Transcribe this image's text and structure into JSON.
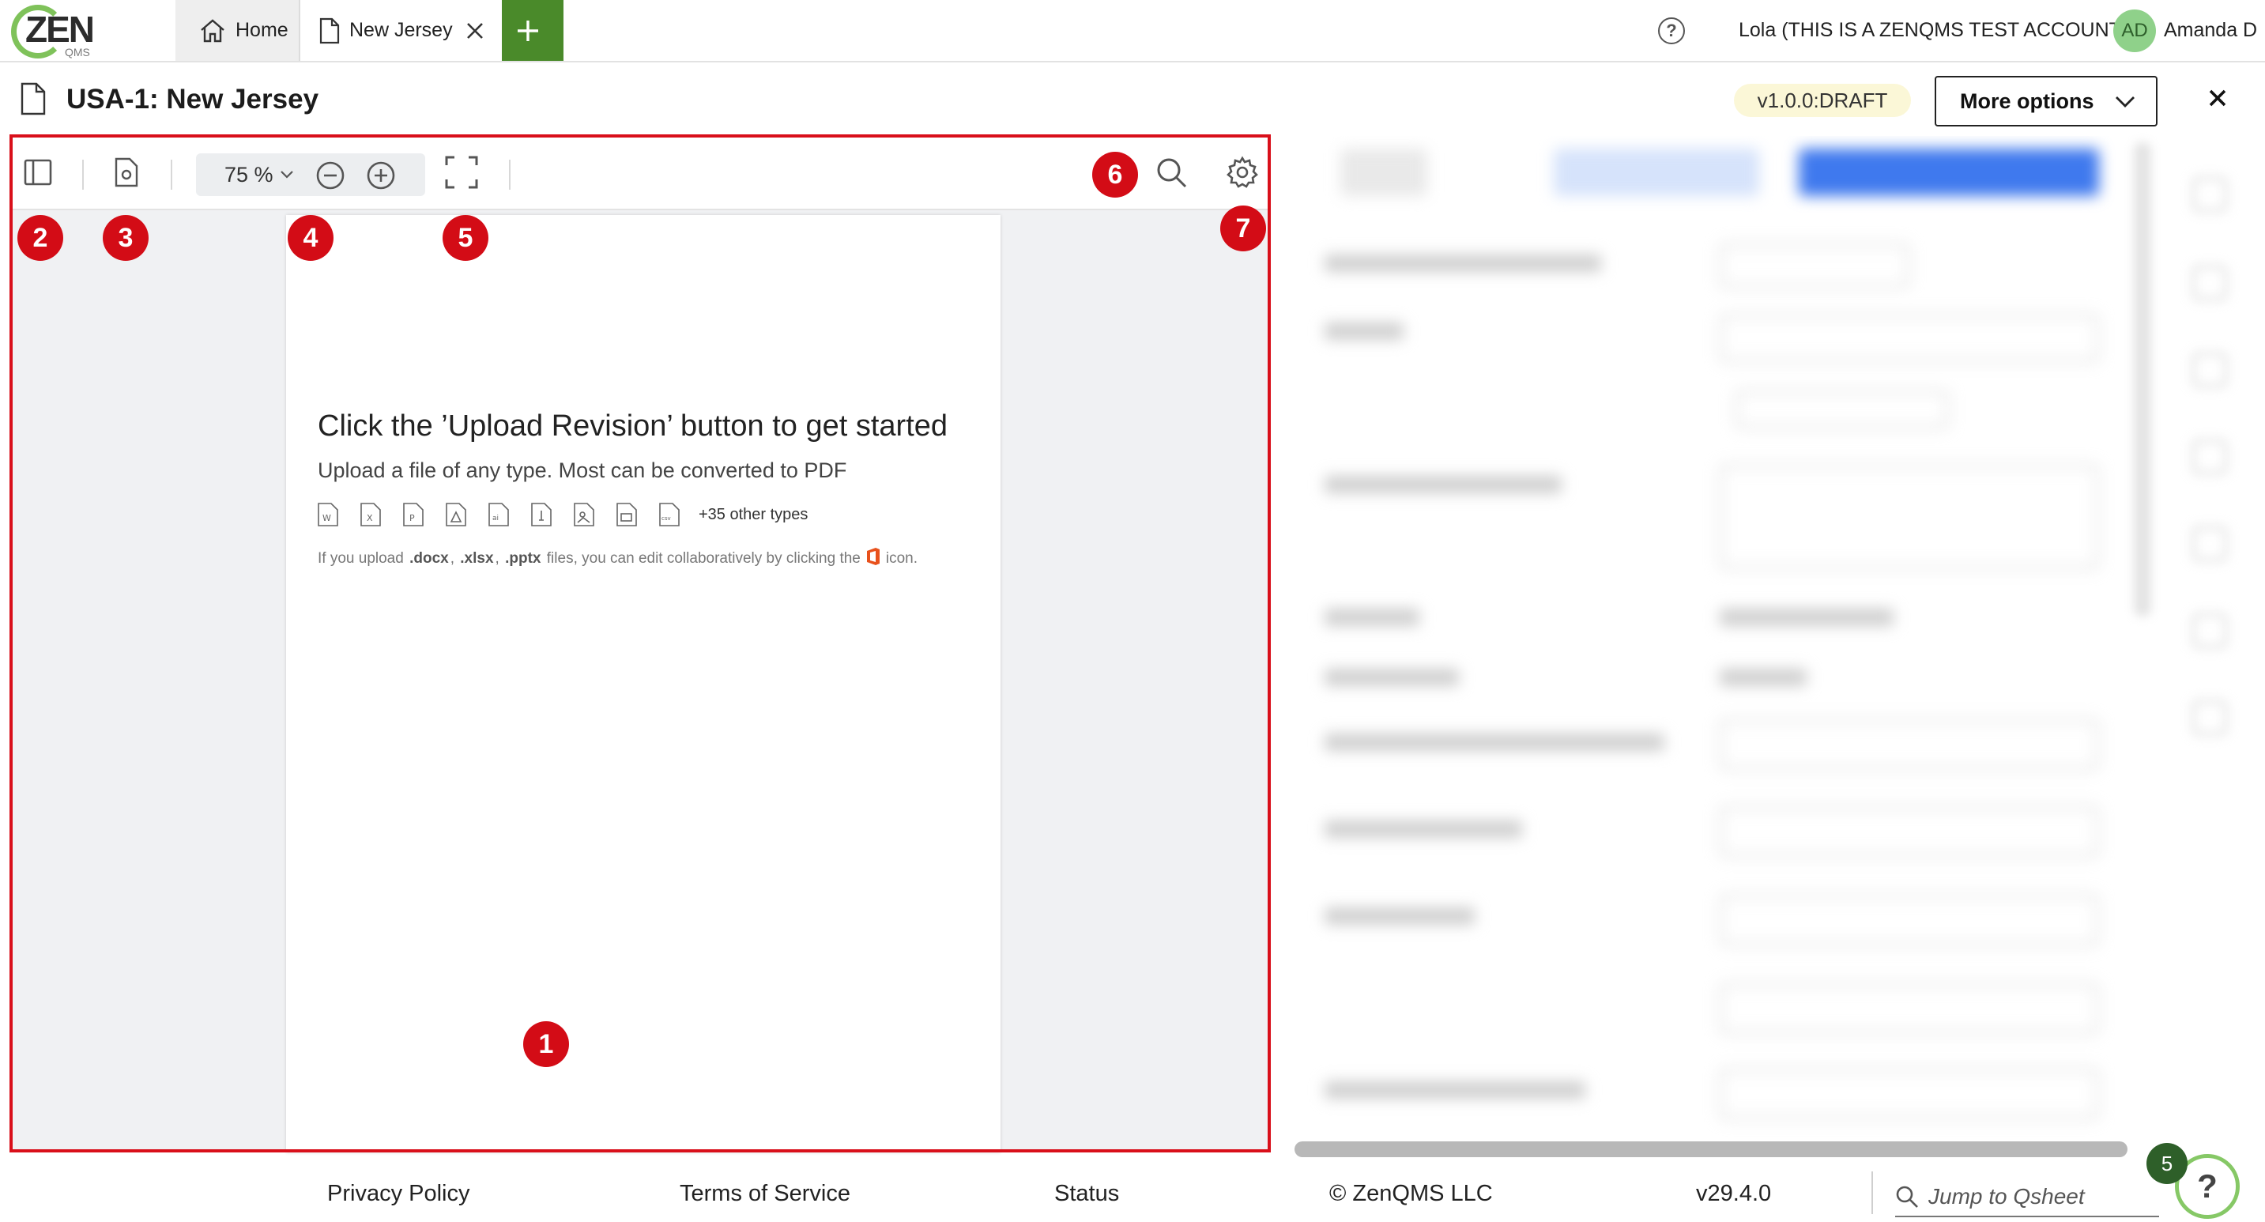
{
  "logo": {
    "wordmark": "ZEN",
    "sub": "QMS"
  },
  "tabs": [
    {
      "label": "Home",
      "icon": "home-icon"
    },
    {
      "label": "New Jersey",
      "icon": "document-icon"
    },
    {
      "label": "",
      "icon": "plus-icon"
    }
  ],
  "header": {
    "help_glyph": "?",
    "account": "Lola (THIS IS A ZENQMS TEST ACCOUNT)",
    "avatar_initials": "AD",
    "user": "Amanda D"
  },
  "title_row": {
    "title": "USA-1: New Jersey",
    "version": "v1.0.0:DRAFT",
    "more_options": "More options"
  },
  "viewer": {
    "zoom": "75 %",
    "page": {
      "heading": "Click the ’Upload Revision’ button to get started",
      "subheading": "Upload a file of any type. Most can be converted to PDF",
      "file_types": [
        "W",
        "X",
        "P",
        "A",
        "ai",
        "A",
        "img",
        "dd",
        "csv"
      ],
      "other_types": "+35 other types",
      "note_prefix": "If you upload",
      "note_ext1": ".docx",
      "note_comma1": ",",
      "note_ext2": ".xlsx",
      "note_comma2": ",",
      "note_ext3": ".pptx",
      "note_mid": "files, you can edit collaboratively by clicking the",
      "note_suffix": "icon."
    }
  },
  "callouts": [
    "1",
    "2",
    "3",
    "4",
    "5",
    "6",
    "7"
  ],
  "footer": {
    "privacy": "Privacy Policy",
    "terms": "Terms of Service",
    "status": "Status",
    "copyright": "© ZenQMS LLC",
    "version": "v29.4.0",
    "jump_placeholder": "Jump to Qsheet",
    "help_count": "5",
    "help_glyph": "?"
  },
  "colors": {
    "accent_red": "#d30c16",
    "brand_green": "#4a8a2a",
    "badge_yellow": "#fbf7d7"
  }
}
